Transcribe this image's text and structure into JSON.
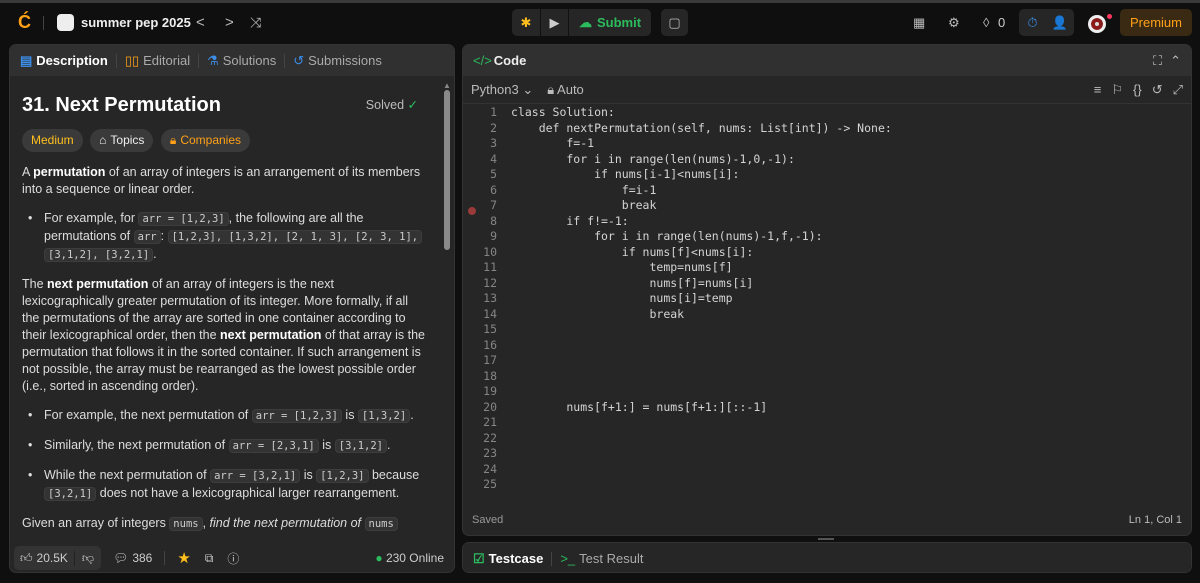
{
  "topbar": {
    "list_name": "summer pep 2025",
    "submit": "Submit",
    "streak": "0",
    "premium": "Premium"
  },
  "tabs": [
    {
      "label": "Description"
    },
    {
      "label": "Editorial"
    },
    {
      "label": "Solutions"
    },
    {
      "label": "Submissions"
    }
  ],
  "problem": {
    "title": "31. Next Permutation",
    "status": "Solved",
    "difficulty": "Medium",
    "topics": "Topics",
    "companies": "Companies"
  },
  "description": [
    {
      "type": "p",
      "segs": [
        [
          "t",
          "A "
        ],
        [
          "b",
          "permutation"
        ],
        [
          "t",
          " of an array of integers is an arrangement of its members into a sequence or linear order."
        ]
      ]
    },
    {
      "type": "li",
      "segs": [
        [
          "t",
          "For example, for "
        ],
        [
          "c",
          "arr = [1,2,3]"
        ],
        [
          "t",
          ", the following are all the permutations of "
        ],
        [
          "c",
          "arr"
        ],
        [
          "t",
          ": "
        ],
        [
          "c",
          "[1,2,3], [1,3,2], [2, 1, 3], [2, 3, 1],"
        ],
        [
          "t",
          " "
        ],
        [
          "c",
          "[3,1,2], [3,2,1]"
        ],
        [
          "t",
          "."
        ]
      ]
    },
    {
      "type": "p",
      "segs": [
        [
          "t",
          "The "
        ],
        [
          "b",
          "next permutation"
        ],
        [
          "t",
          " of an array of integers is the next lexicographically greater permutation of its integer. More formally, if all the permutations of the array are sorted in one container according to their lexicographical order, then the "
        ],
        [
          "b",
          "next permutation"
        ],
        [
          "t",
          " of that array is the permutation that follows it in the sorted container. If such arrangement is not possible, the array must be rearranged as the lowest possible order (i.e., sorted in ascending order)."
        ]
      ]
    },
    {
      "type": "li",
      "segs": [
        [
          "t",
          "For example, the next permutation of "
        ],
        [
          "c",
          "arr = [1,2,3]"
        ],
        [
          "t",
          " is "
        ],
        [
          "c",
          "[1,3,2]"
        ],
        [
          "t",
          "."
        ]
      ]
    },
    {
      "type": "li",
      "segs": [
        [
          "t",
          "Similarly, the next permutation of "
        ],
        [
          "c",
          "arr = [2,3,1]"
        ],
        [
          "t",
          " is "
        ],
        [
          "c",
          "[3,1,2]"
        ],
        [
          "t",
          "."
        ]
      ]
    },
    {
      "type": "li",
      "segs": [
        [
          "t",
          "While the next permutation of "
        ],
        [
          "c",
          "arr = [3,2,1]"
        ],
        [
          "t",
          " is "
        ],
        [
          "c",
          "[1,2,3]"
        ],
        [
          "t",
          " because "
        ],
        [
          "c",
          "[3,2,1]"
        ],
        [
          "t",
          " does not have a lexicographical larger rearrangement."
        ]
      ]
    },
    {
      "type": "p",
      "segs": [
        [
          "t",
          "Given an array of integers "
        ],
        [
          "c",
          "nums"
        ],
        [
          "t",
          ", "
        ],
        [
          "i",
          "find the next permutation of"
        ],
        [
          "t",
          " "
        ],
        [
          "c",
          "nums"
        ]
      ]
    }
  ],
  "footer": {
    "likes": "20.5K",
    "comments": "386",
    "online": "230 Online"
  },
  "editor": {
    "title": "Code",
    "language": "Python3",
    "mode": "Auto",
    "status": "Saved",
    "cursor": "Ln 1, Col 1",
    "lines": [
      "class Solution:",
      "    def nextPermutation(self, nums: List[int]) -> None:",
      "        f=-1",
      "        for i in range(len(nums)-1,0,-1):",
      "            if nums[i-1]<nums[i]:",
      "                f=i-1",
      "                break",
      "        if f!=-1:",
      "            for i in range(len(nums)-1,f,-1):",
      "                if nums[f]<nums[i]:",
      "                    temp=nums[f]",
      "                    nums[f]=nums[i]",
      "                    nums[i]=temp",
      "                    break",
      "",
      "",
      "",
      "",
      "",
      "        nums[f+1:] = nums[f+1:][::-1]",
      "",
      "",
      "",
      "",
      ""
    ]
  },
  "bottom": {
    "testcase": "Testcase",
    "test_result": "Test Result"
  },
  "colors": {
    "accent_green": "#2cbb5d",
    "medium": "#ffc01e",
    "premium": "#ffa116"
  }
}
